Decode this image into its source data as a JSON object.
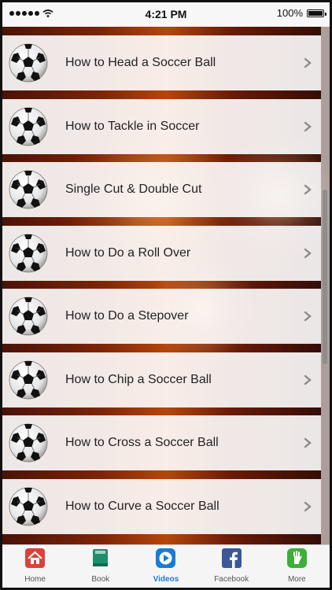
{
  "status_bar": {
    "time": "4:21 PM",
    "battery": "100%",
    "battery_level": 1.0
  },
  "list": {
    "items": [
      {
        "label": "How to Head a Soccer Ball"
      },
      {
        "label": "How to Tackle in Soccer"
      },
      {
        "label": "Single Cut & Double Cut"
      },
      {
        "label": "How to Do a Roll Over"
      },
      {
        "label": "How to Do a Stepover"
      },
      {
        "label": "How to Chip a Soccer Ball"
      },
      {
        "label": "How to Cross a Soccer Ball"
      },
      {
        "label": "How to Curve a Soccer Ball"
      }
    ]
  },
  "tab_bar": {
    "tabs": [
      {
        "label": "Home",
        "icon": "home-icon"
      },
      {
        "label": "Book",
        "icon": "book-icon"
      },
      {
        "label": "Videos",
        "icon": "video-play-icon"
      },
      {
        "label": "Facebook",
        "icon": "facebook-icon"
      },
      {
        "label": "More",
        "icon": "more-hand-icon"
      }
    ],
    "active_tab": "Videos"
  },
  "colors": {
    "accent": "#1a7bd6",
    "background_brown": "#7c2408"
  }
}
